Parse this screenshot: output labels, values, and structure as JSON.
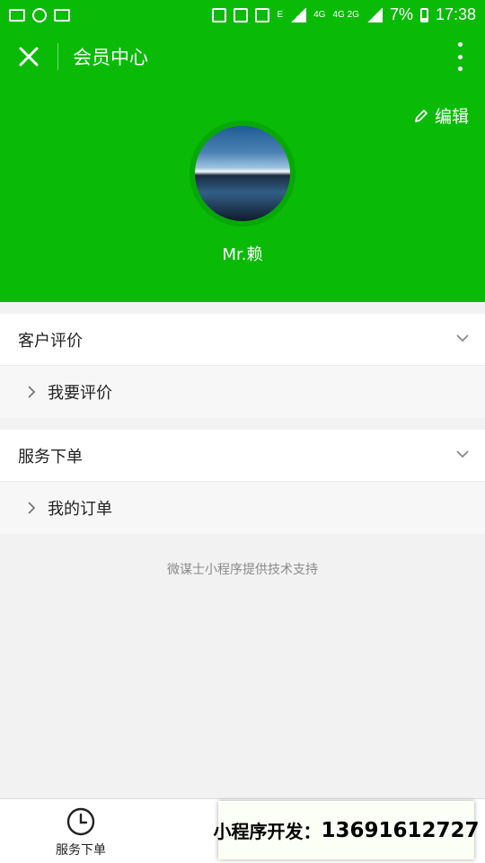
{
  "status_bar": {
    "left_icons": [
      "gallery-icon",
      "wechat-notify-icon",
      "calendar-icon"
    ],
    "network_small": "E",
    "network_4g": "4G",
    "network_4g_2g": "4G 2G",
    "battery_percent": "7%",
    "time": "17:38"
  },
  "header": {
    "title": "会员中心"
  },
  "profile": {
    "edit_label": "编辑",
    "username": "Mr.赖"
  },
  "sections": [
    {
      "title": "客户评价",
      "items": [
        "我要评价"
      ]
    },
    {
      "title": "服务下单",
      "items": [
        "我的订单"
      ]
    }
  ],
  "footer": {
    "support_text": "微谋士小程序提供技术支持"
  },
  "tabbar": {
    "tab1_label": "服务下单"
  },
  "watermark": {
    "prefix": "小程序开发：",
    "phone": "13691612727"
  },
  "colors": {
    "brand_green": "#09bb07"
  }
}
